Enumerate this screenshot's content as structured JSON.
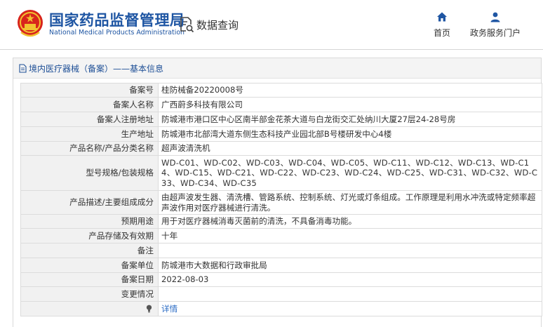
{
  "header": {
    "org_name_cn": "国家药品监督管理局",
    "org_name_en": "National Medical Products Administration",
    "query_label": "数据查询",
    "nav": [
      {
        "label": "首页",
        "icon": "home-icon"
      },
      {
        "label": "政务服务门户",
        "icon": "user-icon"
      }
    ]
  },
  "breadcrumb": "境内医疗器械（备案）——基本信息",
  "record": {
    "rows": [
      {
        "label": "备案号",
        "value": "桂防械备20220008号"
      },
      {
        "label": "备案人名称",
        "value": "广西蔚多科技有限公司"
      },
      {
        "label": "备案人注册地址",
        "value": "防城港市港口区中心区南半部金花茶大道与白龙街交汇处纳川大厦27层24-28号房"
      },
      {
        "label": "生产地址",
        "value": "防城港市北部湾大道东侧生态科技产业园北部B号楼研发中心4楼"
      },
      {
        "label": "产品名称/产品分类名称",
        "value": "超声波清洗机"
      },
      {
        "label": "型号规格/包装规格",
        "value": "WD-C01、WD-C02、WD-C03、WD-C04、WD-C05、WD-C11、WD-C12、WD-C13、WD-C14、WD-C15、WD-C21、WD-C22、WD-C23、WD-C24、WD-C25、WD-C31、WD-C32、WD-C33、WD-C34、WD-C35"
      },
      {
        "label": "产品描述/主要组成成分",
        "value": "由超声波发生器、清洗槽、管路系统、控制系统、灯光或灯条组成。工作原理是利用水冲洗或特定频率超声波作用对医疗器械进行清洗。"
      },
      {
        "label": "预期用途",
        "value": "用于对医疗器械消毒灭菌前的清洗，不具备消毒功能。"
      },
      {
        "label": "产品存储及有效期",
        "value": "十年"
      },
      {
        "label": "备注",
        "value": ""
      },
      {
        "label": "备案单位",
        "value": "防城港市大数据和行政审批局"
      },
      {
        "label": "备案日期",
        "value": "2022-08-03"
      },
      {
        "label": "变更情况",
        "value": ""
      }
    ],
    "detail_link": "详情"
  }
}
